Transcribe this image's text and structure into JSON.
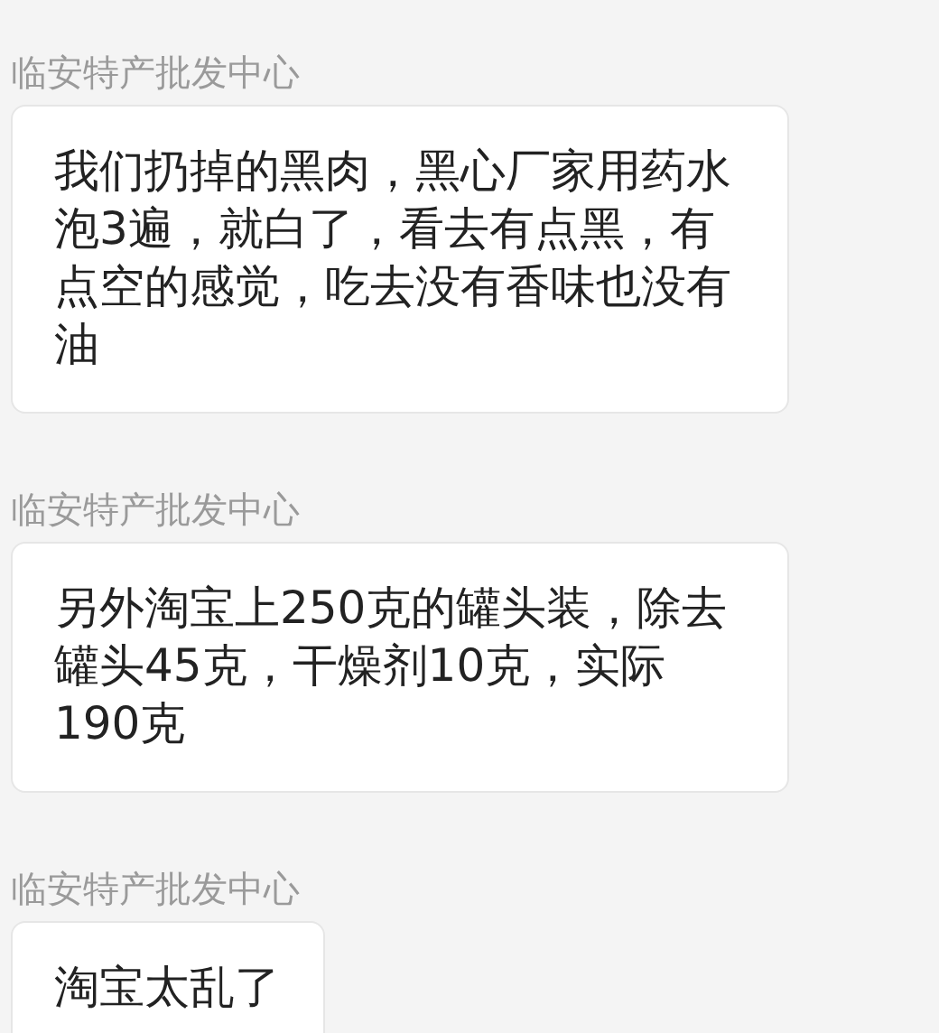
{
  "messages": [
    {
      "sender": "临安特产批发中心",
      "text": "我们扔掉的黑肉，黑心厂家用药水泡3遍，就白了，看去有点黑，有点空的感觉，吃去没有香味也没有油"
    },
    {
      "sender": "临安特产批发中心",
      "text": "另外淘宝上250克的罐头装，除去罐头45克，干燥剂10克，实际190克"
    },
    {
      "sender": "临安特产批发中心",
      "text": "淘宝太乱了"
    }
  ]
}
